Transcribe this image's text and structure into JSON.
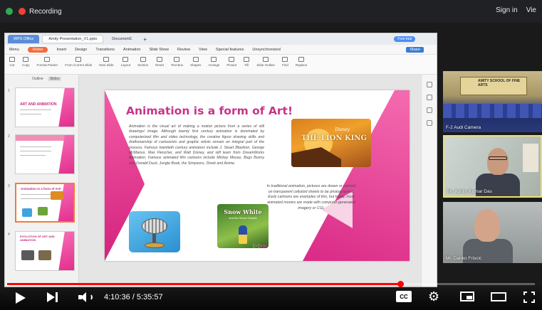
{
  "recording_bar": {
    "recording_label": "Recording",
    "sign_in": "Sign in",
    "view": "Vie"
  },
  "app": {
    "tabs": [
      "WPS Office",
      "Amity Presentation_V1.pptx",
      "Document1"
    ],
    "free_trial": "Free trial",
    "menu": [
      "Menu",
      "Home",
      "Insert",
      "Design",
      "Transitions",
      "Animation",
      "Slide Show",
      "Review",
      "View",
      "Special features",
      "Unsynchronized",
      "Share"
    ],
    "ribbon": [
      "Cut",
      "Copy",
      "Format Painter",
      "From Current Slide",
      "New Slide",
      "Layout",
      "Section",
      "Reset",
      "Text Box",
      "Shapes",
      "Arrange",
      "Picture",
      "Fill",
      "Slide Outline",
      "Find",
      "Replace"
    ],
    "panel_tabs": [
      "Outline",
      "Slides"
    ]
  },
  "thumbnails": [
    {
      "num": "1",
      "title": "ART AND ANIMATION"
    },
    {
      "num": "2",
      "title": ""
    },
    {
      "num": "3",
      "title": "Animation is a form of Art!"
    },
    {
      "num": "4",
      "title": "EVOLUTION OF ART AND ANIMATION"
    }
  ],
  "slide": {
    "title": "Animation is a form of Art!",
    "body": "Animation is the visual art of making a motion picture from a series of still drawings/ image. Although twenty first century animation is dominated by computerized film and video technology, the creative figure drawing skills and draftsmanship of cartoonists and graphic artists remain an integral part of the process. Famous twentieth century animators include J. Stuart Blackton, George McManus, Max Fleischer, and Walt Disney, and still learn from DreamWorks Animation. Famous animated film cartoons include Mickey Mouse, Bugs Bunny and Donald Duck, Jungle Book, the Simpsons, Shrek and Anime.",
    "body2": "In traditional animation, pictures are drawn or painted on transparent celluloid sheets to be photographed. Early cartoons are examples of this, but today, most animated movies are made with computer-generated imagery or CGI.",
    "lion_brand": "Disney",
    "lion_title": "THE LION KING",
    "snow_title": "Snow White",
    "snow_sub": "and the Seven Dwarfs"
  },
  "participants": [
    {
      "name": "F-2 Audi Camera",
      "banner": "AMITY SCHOOL OF FINE ARTS"
    },
    {
      "name": "Mr. Ashim Kumar Das"
    },
    {
      "name": "Mr. Danko Friscic"
    }
  ],
  "player": {
    "time": "4:10:36 / 5:35:57",
    "progress": 0.745,
    "cc": "CC"
  }
}
